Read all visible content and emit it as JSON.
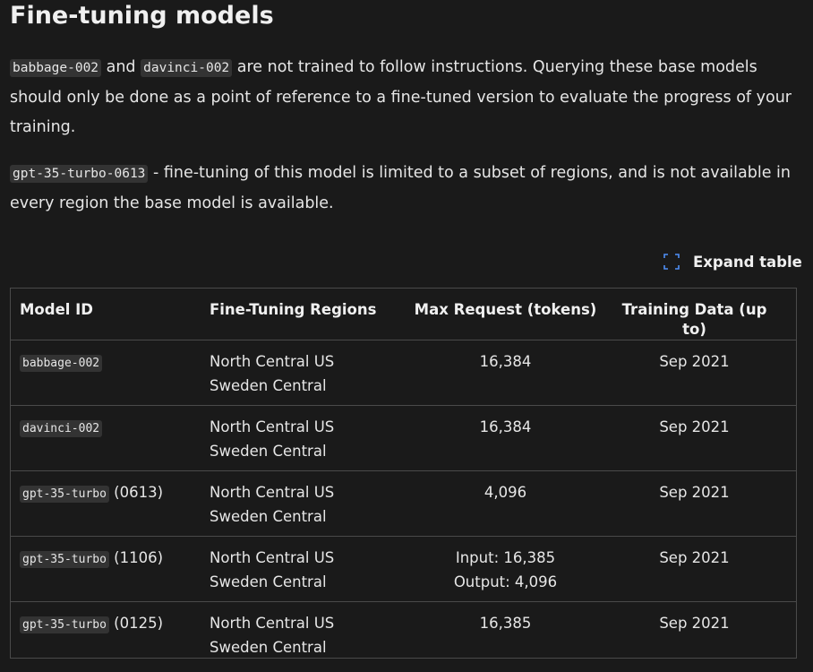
{
  "title": "Fine-tuning models",
  "paragraph1": {
    "code1": "babbage-002",
    "and": "and",
    "code2": "davinci-002",
    "text": "are not trained to follow instructions. Querying these base models should only be done as a point of reference to a fine-tuned version to evaluate the progress of your training."
  },
  "paragraph2": {
    "code": "gpt-35-turbo-0613",
    "text": "- fine-tuning of this model is limited to a subset of regions, and is not available in every region the base model is available."
  },
  "expand_table": {
    "label": "Expand table",
    "icon": "expand-icon"
  },
  "table": {
    "headers": [
      "Model ID",
      "Fine-Tuning Regions",
      "Max Request (tokens)",
      "Training Data (up to)"
    ],
    "rows": [
      {
        "model_code": "babbage-002",
        "model_suffix": "",
        "regions": [
          "North Central US",
          "Sweden Central"
        ],
        "max_request": [
          "16,384"
        ],
        "training_data": "Sep 2021"
      },
      {
        "model_code": "davinci-002",
        "model_suffix": "",
        "regions": [
          "North Central US",
          "Sweden Central"
        ],
        "max_request": [
          "16,384"
        ],
        "training_data": "Sep 2021"
      },
      {
        "model_code": "gpt-35-turbo",
        "model_suffix": "(0613)",
        "regions": [
          "North Central US",
          "Sweden Central"
        ],
        "max_request": [
          "4,096"
        ],
        "training_data": "Sep 2021"
      },
      {
        "model_code": "gpt-35-turbo",
        "model_suffix": "(1106)",
        "regions": [
          "North Central US",
          "Sweden Central"
        ],
        "max_request": [
          "Input: 16,385",
          "Output: 4,096"
        ],
        "training_data": "Sep 2021"
      },
      {
        "model_code": "gpt-35-turbo",
        "model_suffix": "(0125)",
        "regions": [
          "North Central US",
          "Sweden Central"
        ],
        "max_request": [
          "16,385"
        ],
        "training_data": "Sep 2021"
      }
    ]
  }
}
